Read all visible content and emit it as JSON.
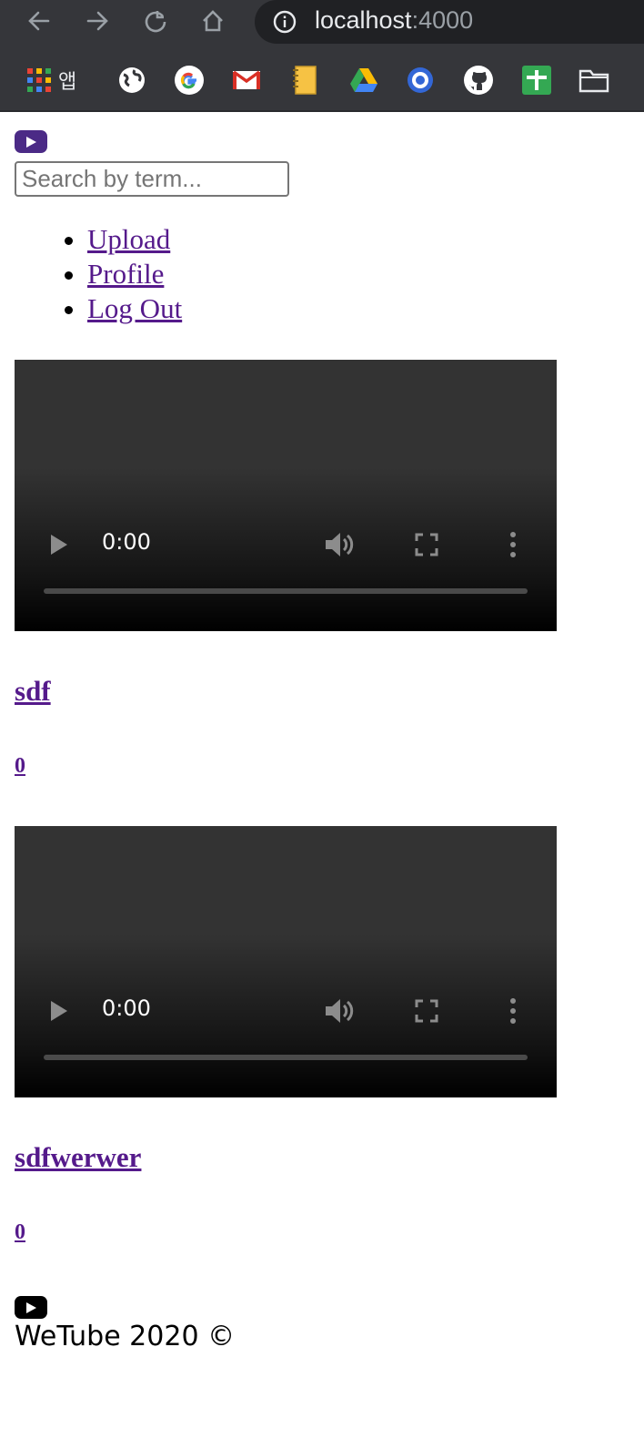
{
  "browser": {
    "url_host": "localhost",
    "url_port": ":4000",
    "bookmarks": {
      "apps_label": "앱"
    }
  },
  "header": {
    "logo_icon": "youtube-logo-icon",
    "search_placeholder": "Search by term...",
    "menu": [
      {
        "label": "Upload"
      },
      {
        "label": "Profile"
      },
      {
        "label": "Log Out"
      }
    ]
  },
  "videos": [
    {
      "time": "0:00",
      "title": "sdf",
      "views": "0"
    },
    {
      "time": "0:00",
      "title": "sdfwerwer",
      "views": "0"
    }
  ],
  "footer": {
    "icon": "youtube-icon",
    "text": "WeTube 2020 ©"
  },
  "colors": {
    "logo_purple": "#4b2a86",
    "link": "#551a8b",
    "chrome": "#35363a"
  }
}
